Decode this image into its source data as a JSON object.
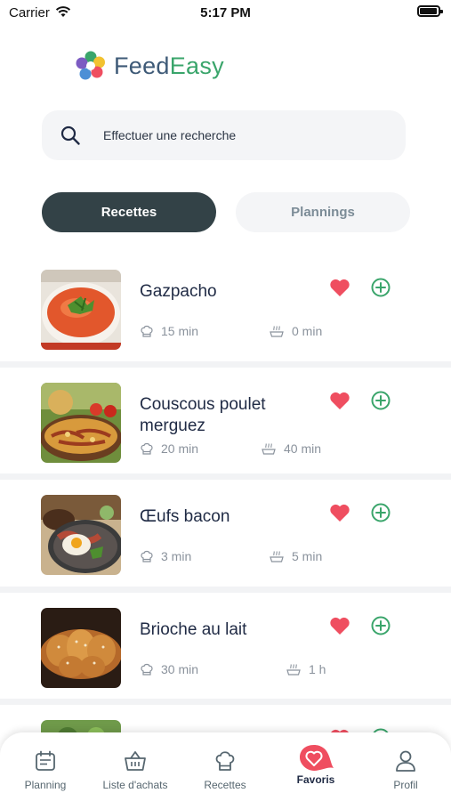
{
  "status_bar": {
    "carrier": "Carrier",
    "time": "5:17 PM"
  },
  "logo": {
    "part1": "Feed",
    "part2": "Easy"
  },
  "search": {
    "placeholder": "Effectuer une recherche"
  },
  "tabs": [
    {
      "label": "Recettes",
      "active": true
    },
    {
      "label": "Plannings",
      "active": false
    }
  ],
  "recipes": [
    {
      "title": "Gazpacho",
      "prep_time": "15 min",
      "cook_time": "0 min",
      "favorite": true
    },
    {
      "title": "Couscous poulet merguez",
      "prep_time": "20 min",
      "cook_time": "40 min",
      "favorite": true
    },
    {
      "title": "Œufs bacon",
      "prep_time": "3 min",
      "cook_time": "5 min",
      "favorite": true
    },
    {
      "title": "Brioche au lait",
      "prep_time": "30 min",
      "cook_time": "1 h",
      "favorite": true
    }
  ],
  "tabbar": [
    {
      "label": "Planning",
      "icon": "calendar-icon",
      "active": false
    },
    {
      "label": "Liste d'achats",
      "icon": "basket-icon",
      "active": false
    },
    {
      "label": "Recettes",
      "icon": "chef-hat-icon",
      "active": false
    },
    {
      "label": "Favoris",
      "icon": "heart-icon",
      "active": true
    },
    {
      "label": "Profil",
      "icon": "user-icon",
      "active": false
    }
  ],
  "colors": {
    "accent_green": "#3aa56b",
    "heart_red": "#ef4e60",
    "dark_tab": "#334247"
  }
}
